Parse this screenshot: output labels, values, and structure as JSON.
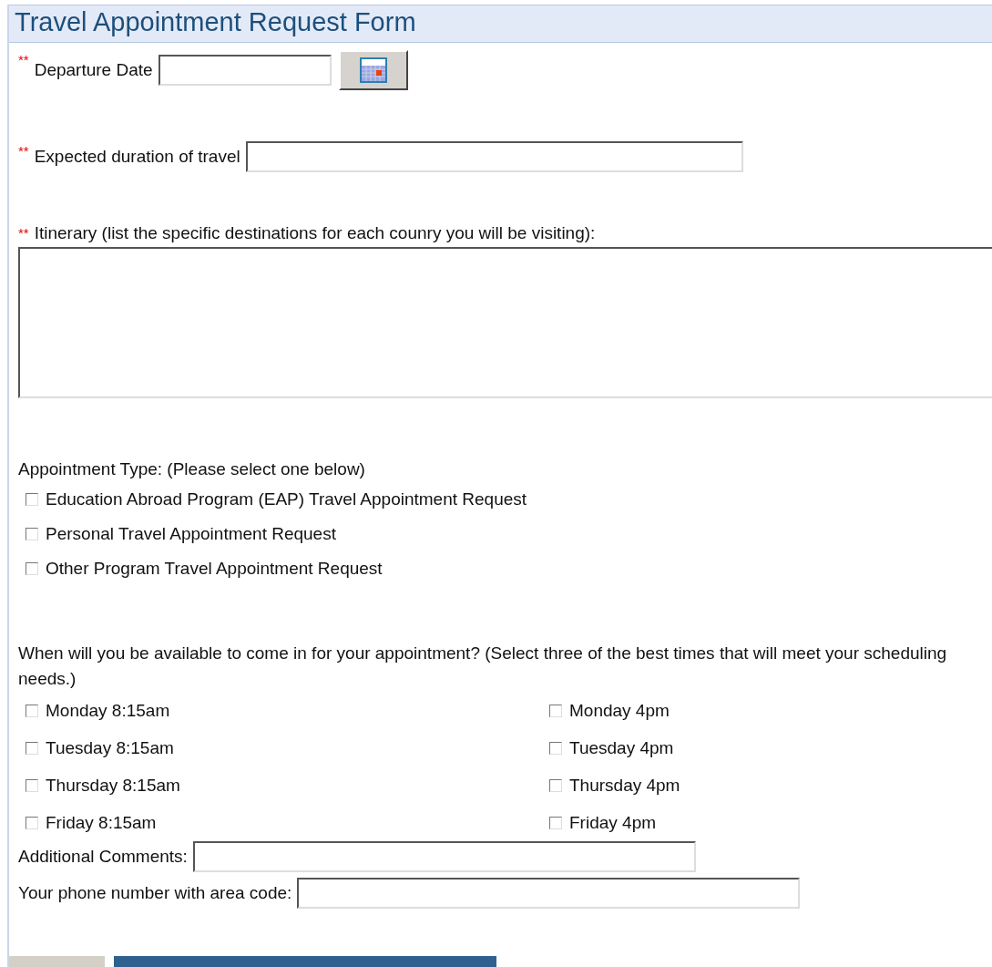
{
  "title": "Travel Appointment Request Form",
  "departure": {
    "required_mark": "**",
    "label": "Departure Date"
  },
  "duration": {
    "required_mark": "**",
    "label": "Expected duration of travel"
  },
  "itinerary": {
    "required_mark": "**",
    "label": "Itinerary (list the specific destinations for each counry you will be visiting):"
  },
  "appointment_type": {
    "label": "Appointment Type: (Please select one below)",
    "options": [
      {
        "label": "Education Abroad Program (EAP) Travel Appointment Request",
        "checked": false
      },
      {
        "label": "Personal Travel Appointment Request",
        "checked": false
      },
      {
        "label": "Other Program Travel Appointment Request",
        "checked": false
      }
    ]
  },
  "availability": {
    "label": "When will you be available to come in for your appointment? (Select three of the best times that will meet your scheduling needs.)",
    "times": [
      {
        "label": "Monday 8:15am",
        "checked": false
      },
      {
        "label": "Monday 4pm",
        "checked": false
      },
      {
        "label": "Tuesday 8:15am",
        "checked": false
      },
      {
        "label": "Tuesday 4pm",
        "checked": false
      },
      {
        "label": "Thursday 8:15am",
        "checked": false
      },
      {
        "label": "Thursday 4pm",
        "checked": false
      },
      {
        "label": "Friday 8:15am",
        "checked": false
      },
      {
        "label": "Friday 4pm",
        "checked": false
      }
    ]
  },
  "comments": {
    "label": "Additional Comments:"
  },
  "phone": {
    "label": "Your phone number with area code:"
  }
}
